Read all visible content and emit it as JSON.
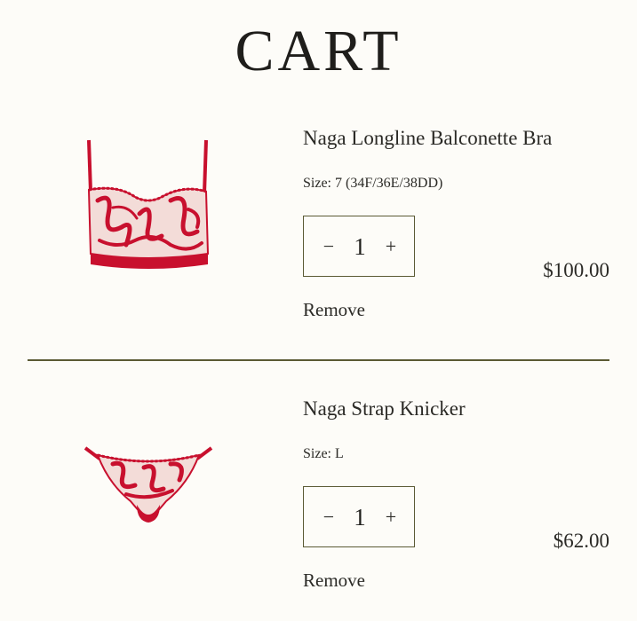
{
  "page": {
    "title": "CART"
  },
  "items": [
    {
      "name": "Naga Longline Balconette Bra",
      "size": "Size: 7 (34F/36E/38DD)",
      "quantity": "1",
      "decrease_symbol": "−",
      "increase_symbol": "+",
      "price": "$100.00",
      "remove_label": "Remove",
      "image_icon": "red-lace-bra-image"
    },
    {
      "name": "Naga Strap Knicker",
      "size": "Size: L",
      "quantity": "1",
      "decrease_symbol": "−",
      "increase_symbol": "+",
      "price": "$62.00",
      "remove_label": "Remove",
      "image_icon": "red-lace-knicker-image"
    }
  ],
  "colors": {
    "background": "#fdfcf8",
    "accent_border": "#5b5a34",
    "product_red": "#c8102e",
    "text": "#2b2a26"
  }
}
